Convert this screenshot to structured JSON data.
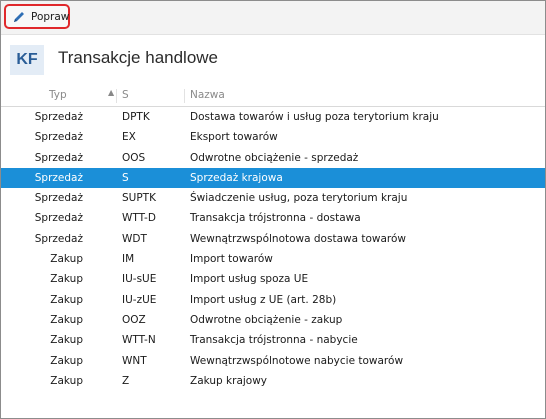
{
  "toolbar": {
    "edit_button_label": "Popraw",
    "edit_button_icon": "pencil-icon"
  },
  "header": {
    "badge": "KF",
    "title": "Transakcje handlowe"
  },
  "table": {
    "columns": {
      "typ": "Typ",
      "symbol": "S",
      "name": "Nazwa"
    },
    "sort": "ascending",
    "selected_row": 3,
    "rows": [
      {
        "typ": "Sprzedaż",
        "symbol": "DPTK",
        "name": "Dostawa towarów i usług poza terytorium kraju"
      },
      {
        "typ": "Sprzedaż",
        "symbol": "EX",
        "name": "Eksport towarów"
      },
      {
        "typ": "Sprzedaż",
        "symbol": "OOS",
        "name": "Odwrotne obciążenie - sprzedaż"
      },
      {
        "typ": "Sprzedaż",
        "symbol": "S",
        "name": "Sprzedaż krajowa"
      },
      {
        "typ": "Sprzedaż",
        "symbol": "SUPTK",
        "name": "Świadczenie usług, poza terytorium kraju"
      },
      {
        "typ": "Sprzedaż",
        "symbol": "WTT-D",
        "name": "Transakcja trójstronna - dostawa"
      },
      {
        "typ": "Sprzedaż",
        "symbol": "WDT",
        "name": "Wewnątrzwspólnotowa dostawa towarów"
      },
      {
        "typ": "Zakup",
        "symbol": "IM",
        "name": "Import towarów"
      },
      {
        "typ": "Zakup",
        "symbol": "IU-sUE",
        "name": "Import usług spoza UE"
      },
      {
        "typ": "Zakup",
        "symbol": "IU-zUE",
        "name": "Import usług z UE (art. 28b)"
      },
      {
        "typ": "Zakup",
        "symbol": "OOZ",
        "name": "Odwrotne obciążenie - zakup"
      },
      {
        "typ": "Zakup",
        "symbol": "WTT-N",
        "name": "Transakcja trójstronna - nabycie"
      },
      {
        "typ": "Zakup",
        "symbol": "WNT",
        "name": "Wewnątrzwspólnotowe nabycie towarów"
      },
      {
        "typ": "Zakup",
        "symbol": "Z",
        "name": "Zakup krajowy"
      }
    ]
  },
  "colors": {
    "selection": "#1b8fd8",
    "highlight_border": "#e0282b",
    "badge_bg": "#e3ecf6",
    "badge_text": "#2a5d97"
  }
}
